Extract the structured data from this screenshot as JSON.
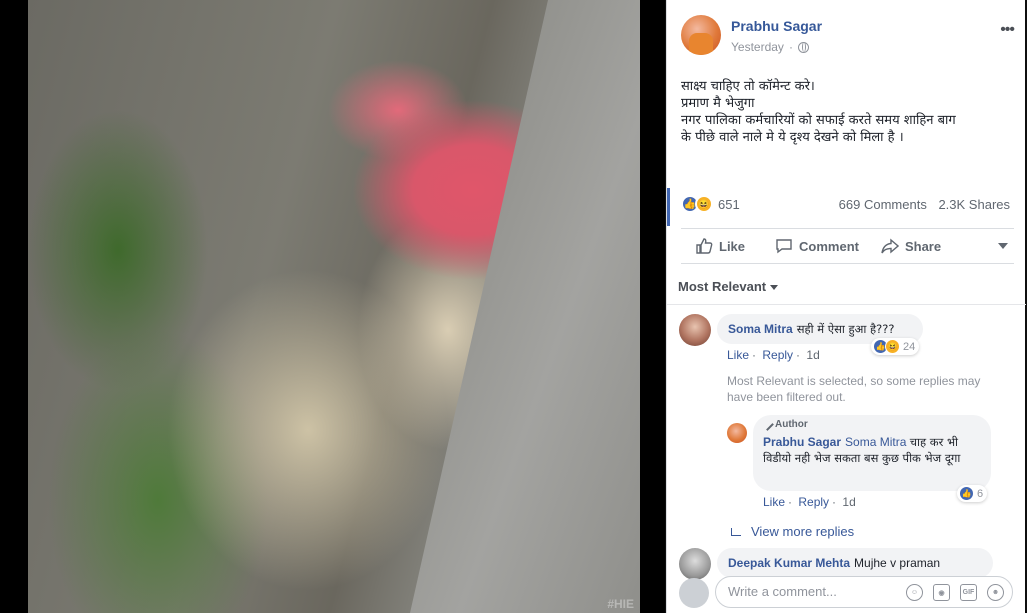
{
  "photo": {
    "watermark": "#HIE"
  },
  "post": {
    "author": "Prabhu Sagar",
    "time": "Yesterday",
    "more_icon": "more-horizontal-icon",
    "privacy_icon": "globe-icon",
    "lines": [
      "साक्ष्य चाहिए तो कॉमेन्ट करे।",
      "प्रमाण मै भेजुगा",
      "नगर पालिका कर्मचारियों को सफाई करते समय शाहिन बाग",
      "के पीछे वाले नाले मे ये दृश्य देखने को मिला है ।"
    ],
    "reactions_count": "651",
    "comments": "669 Comments",
    "shares": "2.3K Shares"
  },
  "actions": {
    "like": "Like",
    "comment": "Comment",
    "share": "Share"
  },
  "filter_label": "Most Relevant",
  "comments": [
    {
      "name": "Soma Mitra",
      "text": "सही में ऐसा हुआ है???",
      "like": "Like",
      "reply": "Reply",
      "age": "1d",
      "reactions": "24"
    }
  ],
  "notice": "Most Relevant is selected, so some replies may have been filtered out.",
  "reply": {
    "badge": "Author",
    "name": "Prabhu Sagar",
    "mention": "Soma Mitra",
    "text": "चाह कर भी विडीयो नही भेज सकता बस कुछ पीक भेज दूगा",
    "like": "Like",
    "reply": "Reply",
    "age": "1d",
    "reactions": "6"
  },
  "view_more": "View more replies",
  "comment3": {
    "name": "Deepak Kumar Mehta",
    "text": "Mujhe v praman"
  },
  "composer": {
    "placeholder": "Write a comment...",
    "gif": "GIF"
  },
  "colors": {
    "link": "#385898",
    "like_blue": "#4267b2",
    "haha_yellow": "#f7b125"
  }
}
